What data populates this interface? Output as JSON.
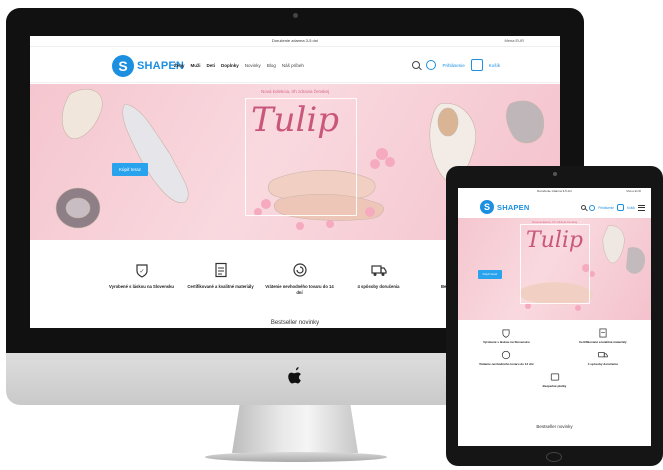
{
  "imac": {
    "apple_logo": "",
    "topbar": {
      "announcement": "Doručenie zdarma 3-5 dní",
      "currency": "Mena EUR"
    },
    "header": {
      "logo_letter": "S",
      "logo_text": "SHAPEN",
      "nav": [
        "Ženy",
        "Muži",
        "Deti",
        "Doplnky",
        "Novinky",
        "Blog",
        "Náš príbeh"
      ],
      "login_label": "Prihlásenie",
      "cart_label": "Košík"
    },
    "hero": {
      "subtitle": "Nová kolekcia, trh zdravia ženskej",
      "title": "Tulip",
      "button_label": "Kúpiť teraz"
    },
    "features": [
      "Vyrobené s láskou na Slovensku",
      "Certifikované a kvalitné materiály",
      "Vrátenie nevhodného tovaru do 14 dní",
      "4 spôsoby doručenia",
      "Bezpečné platby"
    ],
    "bestsellers_heading": "Bestseller novinky"
  },
  "ipad": {
    "topbar": {
      "announcement": "Doručenie zdarma 3-5 dní",
      "currency": "Mena EUR"
    },
    "header": {
      "logo_letter": "S",
      "logo_text": "SHAPEN",
      "login_label": "Prihlásenie",
      "cart_label": "Košík"
    },
    "hero": {
      "subtitle": "Nová kolekcia, trh zdravia ženskej",
      "title": "Tulip",
      "button_label": "Kúpiť teraz"
    },
    "features": [
      "Vyrobené s láskou na Slovensku",
      "Certifikované a kvalitné materiály",
      "Vrátenie nevhodného tovaru do 14 dní",
      "4 spôsoby doručenia",
      "Bezpečné platby"
    ],
    "bestsellers_heading": "Bestseller novinky"
  },
  "colors": {
    "brand_blue": "#1d8fe0",
    "hero_pink": "#f9d9df",
    "title_rose": "#c9577c",
    "button_blue": "#2aa3ef"
  },
  "icons": [
    "search-icon",
    "user-icon",
    "cart-icon",
    "menu-icon",
    "badge-icon",
    "document-icon",
    "return-icon",
    "truck-icon",
    "payment-icon",
    "apple-logo-icon"
  ]
}
